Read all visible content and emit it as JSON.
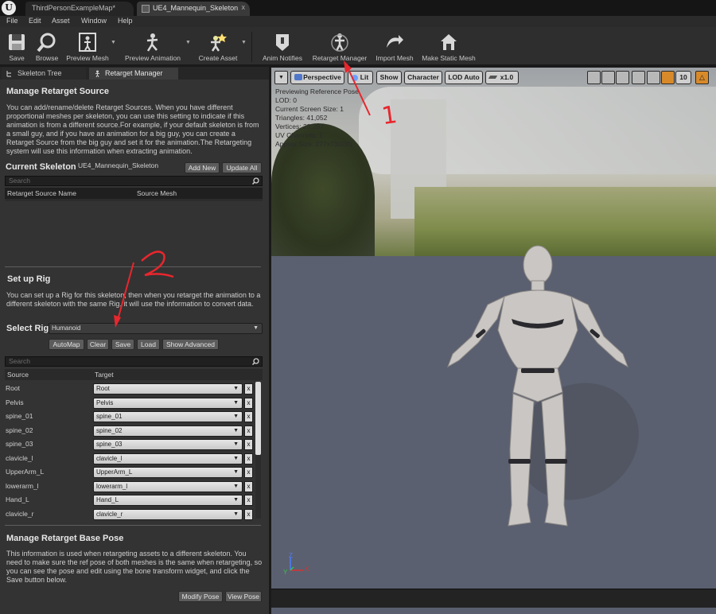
{
  "titlebar": {
    "logo": "U",
    "tabs": [
      {
        "label": "ThirdPersonExampleMap*"
      },
      {
        "label": "UE4_Mannequin_Skeleton"
      }
    ],
    "close_glyph": "x"
  },
  "menu": [
    "File",
    "Edit",
    "Asset",
    "Window",
    "Help"
  ],
  "toolbar": [
    {
      "label": "Save",
      "icon": "save-icon"
    },
    {
      "label": "Browse",
      "icon": "browse-icon"
    },
    {
      "label": "Preview Mesh",
      "icon": "preview-mesh-icon"
    },
    {
      "label": "Preview Animation",
      "icon": "preview-animation-icon"
    },
    {
      "label": "Create Asset",
      "icon": "create-asset-icon"
    },
    {
      "label": "Anim Notifies",
      "icon": "anim-notifies-icon"
    },
    {
      "label": "Retarget Manager",
      "icon": "retarget-manager-icon"
    },
    {
      "label": "Import Mesh",
      "icon": "import-mesh-icon"
    },
    {
      "label": "Make Static Mesh",
      "icon": "make-static-mesh-icon"
    }
  ],
  "panel_tabs": [
    "Skeleton Tree",
    "Retarget Manager"
  ],
  "retarget_source": {
    "heading": "Manage Retarget Source",
    "description": "You can add/rename/delete Retarget Sources. When you have different proportional meshes per skeleton, you can use this setting to indicate if this animation is from a different source.For example, if your default skeleton is from a small guy, and if you have an animation for a big guy, you can create a Retarget Source from the big guy and set it for the animation.The Retargeting system will use this information when extracting animation.",
    "current_skeleton_label": "Current Skeleton",
    "current_skeleton_value": "UE4_Mannequin_Skeleton",
    "add_new": "Add New",
    "update_all": "Update All",
    "search_placeholder": "Search",
    "columns": [
      "Retarget Source Name",
      "Source Mesh"
    ]
  },
  "rig": {
    "heading": "Set up Rig",
    "description": "You can set up a Rig for this skeleton, then when you retarget the animation to a different skeleton with the same Rig, it will use the information to convert data.",
    "select_label": "Select Rig",
    "selected": "Humanoid",
    "buttons": [
      "AutoMap",
      "Clear",
      "Save",
      "Load",
      "Show Advanced"
    ],
    "search_placeholder": "Search",
    "columns": [
      "Source",
      "Target"
    ],
    "rows": [
      {
        "source": "Root",
        "target": "Root"
      },
      {
        "source": "Pelvis",
        "target": "Pelvis"
      },
      {
        "source": "spine_01",
        "target": "spine_01"
      },
      {
        "source": "spine_02",
        "target": "spine_02"
      },
      {
        "source": "spine_03",
        "target": "spine_03"
      },
      {
        "source": "clavicle_l",
        "target": "clavicle_l"
      },
      {
        "source": "UpperArm_L",
        "target": "UpperArm_L"
      },
      {
        "source": "lowerarm_l",
        "target": "lowerarm_l"
      },
      {
        "source": "Hand_L",
        "target": "Hand_L"
      },
      {
        "source": "clavicle_r",
        "target": "clavicle_r"
      }
    ],
    "clear_glyph": "x"
  },
  "base_pose": {
    "heading": "Manage Retarget Base Pose",
    "description": "This information is used when retargeting assets to a different skeleton. You need to make sure the ref pose of both meshes is the same when retargeting, so you can see the pose and edit using the bone transform widget, and click the Save button below.",
    "modify_pose": "Modify Pose",
    "view_pose": "View Pose"
  },
  "viewport": {
    "perspective": "Perspective",
    "lit": "Lit",
    "show": "Show",
    "character": "Character",
    "lod": "LOD Auto",
    "speed": "x1.0",
    "grid_snap": "10",
    "stats": [
      "Previewing Reference Pose",
      "LOD: 0",
      "Current Screen Size: 1",
      "Triangles: 41,052",
      "Vertices: 23,297",
      "UV Channels: 1",
      "Approx Size: 277x73x283"
    ],
    "axes": {
      "z": "Z",
      "x": "X",
      "y": "Y"
    }
  },
  "annotations": [
    "1",
    "2"
  ],
  "colors": {
    "annotation": "#e8262d",
    "panel": "#333333",
    "floor": "#5b6070"
  }
}
